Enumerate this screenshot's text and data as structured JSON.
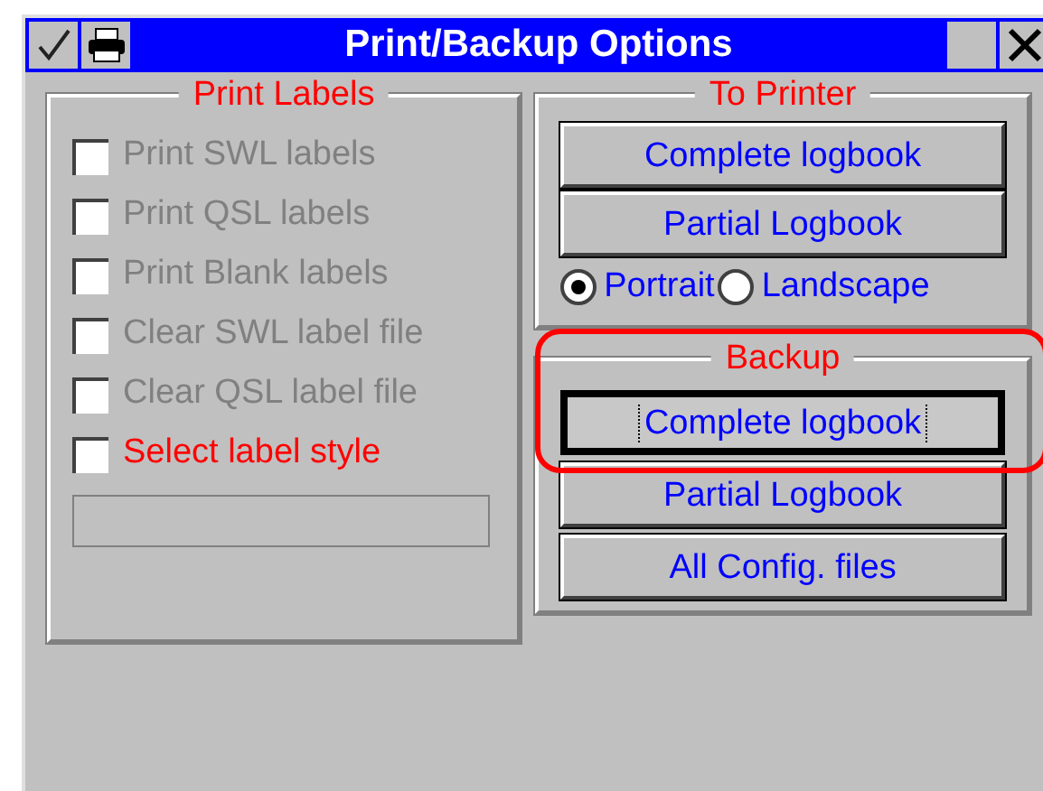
{
  "window": {
    "title": "Print/Backup Options"
  },
  "print_labels": {
    "title": "Print Labels",
    "options": [
      {
        "label": "Print SWL labels",
        "checked": false,
        "disabled": true
      },
      {
        "label": "Print QSL labels",
        "checked": false,
        "disabled": true
      },
      {
        "label": "Print Blank labels",
        "checked": false,
        "disabled": true
      },
      {
        "label": "Clear SWL label file",
        "checked": false,
        "disabled": true
      },
      {
        "label": "Clear QSL label file",
        "checked": false,
        "disabled": true
      },
      {
        "label": "Select label style",
        "checked": false,
        "disabled": false
      }
    ]
  },
  "to_printer": {
    "title": "To Printer",
    "buttons": [
      {
        "label": "Complete logbook",
        "focused": false
      },
      {
        "label": "Partial Logbook",
        "focused": false
      }
    ],
    "orientation": [
      {
        "label": "Portrait",
        "selected": true
      },
      {
        "label": "Landscape",
        "selected": false
      }
    ]
  },
  "backup": {
    "title": "Backup",
    "highlighted": true,
    "buttons": [
      {
        "label": "Complete logbook",
        "focused": true
      },
      {
        "label": "Partial Logbook",
        "focused": false
      },
      {
        "label": "All Config. files",
        "focused": false
      }
    ]
  }
}
